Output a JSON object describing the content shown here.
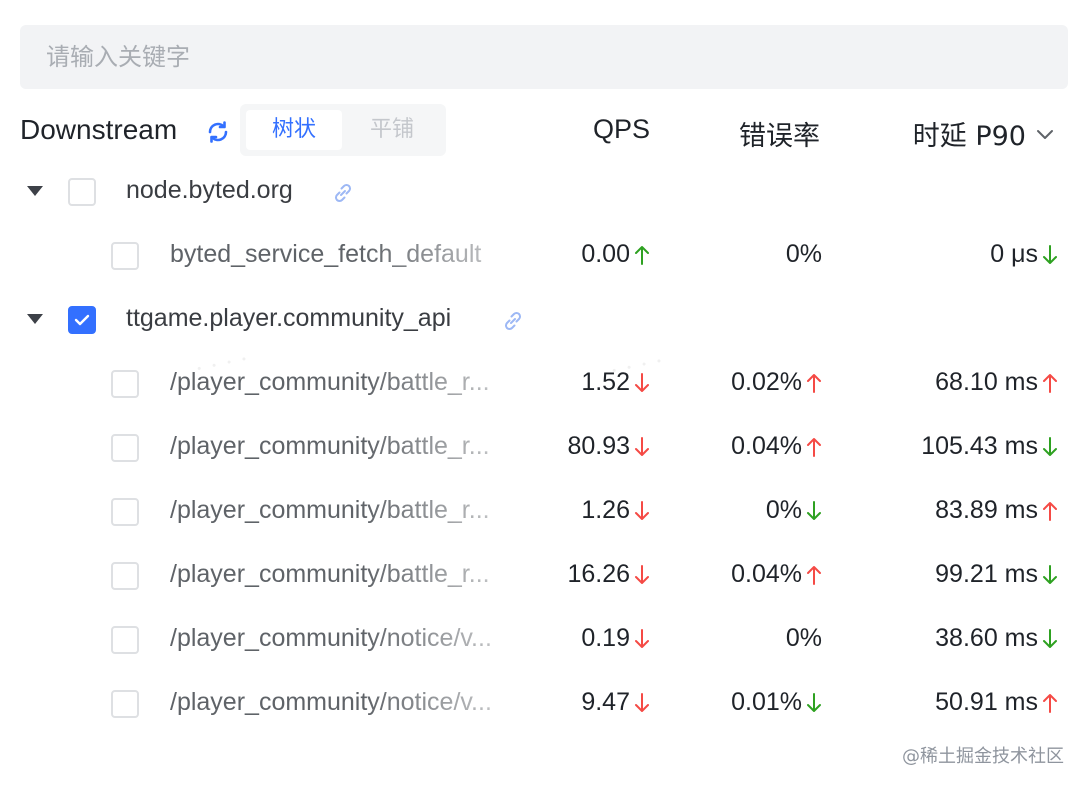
{
  "search": {
    "placeholder": "请输入关键字",
    "value": ""
  },
  "header": {
    "title": "Downstream",
    "view_modes": {
      "tree": "树状",
      "flat": "平铺",
      "selected": "树状"
    },
    "columns": {
      "qps": "QPS",
      "error_rate": "错误率",
      "latency": "时延 P90"
    }
  },
  "groups": [
    {
      "name": "node.byted.org",
      "expanded": true,
      "checked": false,
      "items": [
        {
          "name": "byted_service_fetch_default",
          "qps": "0.00",
          "qps_trend": "up",
          "error_rate": "0%",
          "error_trend": "none",
          "latency": "0 μs",
          "latency_trend": "down",
          "checked": false
        }
      ]
    },
    {
      "name": "ttgame.player.community_api",
      "expanded": true,
      "checked": true,
      "items": [
        {
          "name": "/player_community/battle_r...",
          "qps": "1.52",
          "qps_trend": "down",
          "error_rate": "0.02%",
          "error_trend": "up",
          "latency": "68.10 ms",
          "latency_trend": "up",
          "checked": false
        },
        {
          "name": "/player_community/battle_r...",
          "qps": "80.93",
          "qps_trend": "down",
          "error_rate": "0.04%",
          "error_trend": "up",
          "latency": "105.43 ms",
          "latency_trend": "down",
          "checked": false
        },
        {
          "name": "/player_community/battle_r...",
          "qps": "1.26",
          "qps_trend": "down",
          "error_rate": "0%",
          "error_trend": "down",
          "latency": "83.89 ms",
          "latency_trend": "up",
          "checked": false
        },
        {
          "name": "/player_community/battle_r...",
          "qps": "16.26",
          "qps_trend": "down",
          "error_rate": "0.04%",
          "error_trend": "up",
          "latency": "99.21 ms",
          "latency_trend": "down",
          "checked": false
        },
        {
          "name": "/player_community/notice/v...",
          "qps": "0.19",
          "qps_trend": "down",
          "error_rate": "0%",
          "error_trend": "none",
          "latency": "38.60 ms",
          "latency_trend": "down",
          "checked": false
        },
        {
          "name": "/player_community/notice/v...",
          "qps": "9.47",
          "qps_trend": "down",
          "error_rate": "0.01%",
          "error_trend": "down",
          "latency": "50.91 ms",
          "latency_trend": "up",
          "checked": false
        }
      ]
    }
  ],
  "colors": {
    "accent": "#3370ff",
    "up": "#f54a45",
    "down": "#2ea121",
    "up_qps": "#2ea121",
    "down_qps": "#f54a45"
  },
  "footer_watermark": "@稀土掘金技术社区"
}
